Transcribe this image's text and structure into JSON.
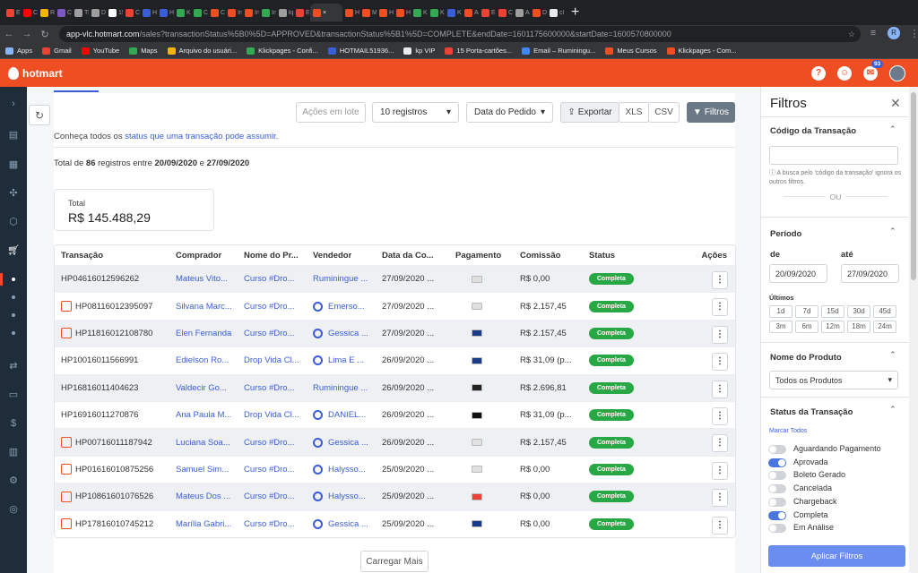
{
  "browser": {
    "tabs": [
      {
        "label": "Er",
        "color": "#ea4335"
      },
      {
        "label": "Cl",
        "color": "#ff0000"
      },
      {
        "label": "Ri",
        "color": "#f4b400"
      },
      {
        "label": "Cl",
        "color": "#7e57c2"
      },
      {
        "label": "Tl",
        "color": "#9e9e9e"
      },
      {
        "label": "Dl",
        "color": "#9e9e9e"
      },
      {
        "label": "15",
        "color": "#ffffff"
      },
      {
        "label": "Cl",
        "color": "#ea4335"
      },
      {
        "label": "H",
        "color": "#3b5ed7"
      },
      {
        "label": "H",
        "color": "#3b5ed7"
      },
      {
        "label": "K",
        "color": "#34a853"
      },
      {
        "label": "C",
        "color": "#34a853"
      },
      {
        "label": "C",
        "color": "#ef4e23"
      },
      {
        "label": "In",
        "color": "#ef4e23"
      },
      {
        "label": "In",
        "color": "#ef4e23"
      },
      {
        "label": "In",
        "color": "#34a853"
      },
      {
        "label": "kp",
        "color": "#9e9e9e"
      },
      {
        "label": "Er",
        "color": "#ea4335"
      },
      {
        "label": "×",
        "color": "#ef4e23",
        "active": true
      },
      {
        "label": "H",
        "color": "#ef4e23"
      },
      {
        "label": "M",
        "color": "#ef4e23"
      },
      {
        "label": "H",
        "color": "#ef4e23"
      },
      {
        "label": "H",
        "color": "#ef4e23"
      },
      {
        "label": "K",
        "color": "#34a853"
      },
      {
        "label": "K",
        "color": "#34a853"
      },
      {
        "label": "K",
        "color": "#3b5ed7"
      },
      {
        "label": "A",
        "color": "#ef4e23"
      },
      {
        "label": "Er",
        "color": "#ea4335"
      },
      {
        "label": "C",
        "color": "#ea4335"
      },
      {
        "label": "A",
        "color": "#9e9e9e"
      },
      {
        "label": "D",
        "color": "#ef4e23"
      },
      {
        "label": "cl",
        "color": "#e8eaed"
      }
    ],
    "new_tab": "+",
    "url_host": "app-vlc.hotmart.com",
    "url_path": "/sales?transactionStatus%5B0%5D=APPROVED&transactionStatus%5B1%5D=COMPLETE&endDate=1601175600000&startDate=1600570800000",
    "profile_initial": "R",
    "bookmarks": [
      {
        "label": "Apps",
        "color": "#8ab4f8"
      },
      {
        "label": "Gmail",
        "color": "#ea4335"
      },
      {
        "label": "YouTube",
        "color": "#ff0000"
      },
      {
        "label": "Maps",
        "color": "#34a853"
      },
      {
        "label": "Arquivo do usuári...",
        "color": "#f4b400"
      },
      {
        "label": "Klickpages - Confi...",
        "color": "#34a853"
      },
      {
        "label": "HOTMAIL51936...",
        "color": "#3b5ed7"
      },
      {
        "label": "kp VIP",
        "color": "#e8eaed"
      },
      {
        "label": "15 Porta-cartões...",
        "color": "#ea4335"
      },
      {
        "label": "Email – Ruminingu...",
        "color": "#4285f4"
      },
      {
        "label": "Meus Cursos",
        "color": "#ef4e23"
      },
      {
        "label": "Klickpages - Com...",
        "color": "#ef4e23"
      }
    ]
  },
  "header": {
    "brand": "hotmart",
    "help_icon": "?",
    "notif_count": "93"
  },
  "toolbar": {
    "refresh_icon": "↻",
    "acoes": "Ações em lote",
    "registros": "10 registros",
    "data": "Data do Pedido",
    "caret": "▾",
    "exportar": "Exportar",
    "xls": "XLS",
    "csv": "CSV",
    "filtros": "Filtros"
  },
  "info": {
    "know_pre": "Conheça todos os ",
    "know_link": "status que uma transação pode assumir",
    "know_post": ".",
    "total_pre": "Total de ",
    "total_count": "86",
    "total_mid": " registros entre ",
    "start": "20/09/2020",
    "and": " e ",
    "end": "27/09/2020"
  },
  "total": {
    "label": "Total",
    "value": "R$ 145.488,29"
  },
  "table": {
    "headers": [
      "Transação",
      "Comprador",
      "Nome do Pr...",
      "Vendedor",
      "Data da Co...",
      "Pagamento",
      "Comissão",
      "Status",
      "Ações"
    ],
    "rows": [
      {
        "id": "HP04616012596262",
        "bag": false,
        "buyer": "Mateus Vito...",
        "product": "Curso #Dro...",
        "seller": "Ruminingue ...",
        "seller_icon": false,
        "date": "27/09/2020 ...",
        "pay": "#e0e0e0",
        "commission": "R$ 0,00",
        "status": "Completa"
      },
      {
        "id": "HP08116012395097",
        "bag": true,
        "buyer": "Silvana Marc...",
        "product": "Curso #Dro...",
        "seller": "Emerso...",
        "seller_icon": true,
        "date": "27/09/2020 ...",
        "pay": "#e0e0e0",
        "commission": "R$ 2.157,45",
        "status": "Completa"
      },
      {
        "id": "HP11816012108780",
        "bag": true,
        "buyer": "Elen Fernanda",
        "product": "Curso #Dro...",
        "seller": "Gessica ...",
        "seller_icon": true,
        "date": "27/09/2020 ...",
        "pay": "#1a3a8a",
        "commission": "R$ 2.157,45",
        "status": "Completa"
      },
      {
        "id": "HP10016011566991",
        "bag": false,
        "buyer": "Edielson Ro...",
        "product": "Drop Vida Cl...",
        "seller": "Lima E ...",
        "seller_icon": true,
        "date": "26/09/2020 ...",
        "pay": "#1a3a8a",
        "commission": "R$ 31,09 (p...",
        "status": "Completa"
      },
      {
        "id": "HP16816011404623",
        "bag": false,
        "buyer": "Valdecir Go...",
        "product": "Curso #Dro...",
        "seller": "Ruminingue ...",
        "seller_icon": false,
        "date": "26/09/2020 ...",
        "pay": "#222222",
        "commission": "R$ 2.696,81",
        "status": "Completa"
      },
      {
        "id": "HP16916011270876",
        "bag": false,
        "buyer": "Ana Paula M...",
        "product": "Drop Vida Cl...",
        "seller": "DANIEL...",
        "seller_icon": true,
        "date": "26/09/2020 ...",
        "pay": "#111111",
        "commission": "R$ 31,09 (p...",
        "status": "Completa"
      },
      {
        "id": "HP00716011187942",
        "bag": true,
        "buyer": "Luciana Soa...",
        "product": "Curso #Dro...",
        "seller": "Gessica ...",
        "seller_icon": true,
        "date": "26/09/2020 ...",
        "pay": "#e0e0e0",
        "commission": "R$ 2.157,45",
        "status": "Completa"
      },
      {
        "id": "HP01616010875256",
        "bag": true,
        "buyer": "Samuel Sim...",
        "product": "Curso #Dro...",
        "seller": "Halysso...",
        "seller_icon": true,
        "date": "25/09/2020 ...",
        "pay": "#e0e0e0",
        "commission": "R$ 0,00",
        "status": "Completa"
      },
      {
        "id": "HP10861601076526",
        "bag": true,
        "buyer": "Mateus Dos ...",
        "product": "Curso #Dro...",
        "seller": "Halysso...",
        "seller_icon": true,
        "date": "25/09/2020 ...",
        "pay": "#ea4335",
        "commission": "R$ 0,00",
        "status": "Completa"
      },
      {
        "id": "HP17816010745212",
        "bag": true,
        "buyer": "Marília Gabri...",
        "product": "Curso #Dro...",
        "seller": "Gessica ...",
        "seller_icon": true,
        "date": "25/09/2020 ...",
        "pay": "#1a3a8a",
        "commission": "R$ 0,00",
        "status": "Completa"
      }
    ],
    "kebab": "⋮"
  },
  "load_more": "Carregar Mais",
  "filters": {
    "title": "Filtros",
    "close": "✕",
    "chev_up": "⌃",
    "code_title": "Código da Transação",
    "code_value": "",
    "code_hint": "ⓘ A busca pelo 'código da transação' ignora os outros filtros.",
    "or": "OU",
    "period_title": "Período",
    "from_label": "de",
    "to_label": "até",
    "from_value": "20/09/2020",
    "to_value": "27/09/2020",
    "last_label": "Últimos",
    "periods": [
      "1d",
      "7d",
      "15d",
      "30d",
      "45d",
      "3m",
      "6m",
      "12m",
      "18m",
      "24m"
    ],
    "product_title": "Nome do Produto",
    "product_value": "Todos os Produtos",
    "status_title": "Status da Transação",
    "mark_all": "Marcar Todos",
    "statuses": [
      {
        "label": "Aguardando Pagamento",
        "on": false
      },
      {
        "label": "Aprovada",
        "on": true
      },
      {
        "label": "Boleto Gerado",
        "on": false
      },
      {
        "label": "Cancelada",
        "on": false
      },
      {
        "label": "Chargeback",
        "on": false
      },
      {
        "label": "Completa",
        "on": true
      },
      {
        "label": "Em Análise",
        "on": false
      }
    ],
    "apply": "Aplicar Filtros"
  },
  "colors": {
    "brand": "#ef4e23",
    "link": "#3b5ed7",
    "status_complete": "#28a745",
    "apply": "#6c8df0"
  }
}
